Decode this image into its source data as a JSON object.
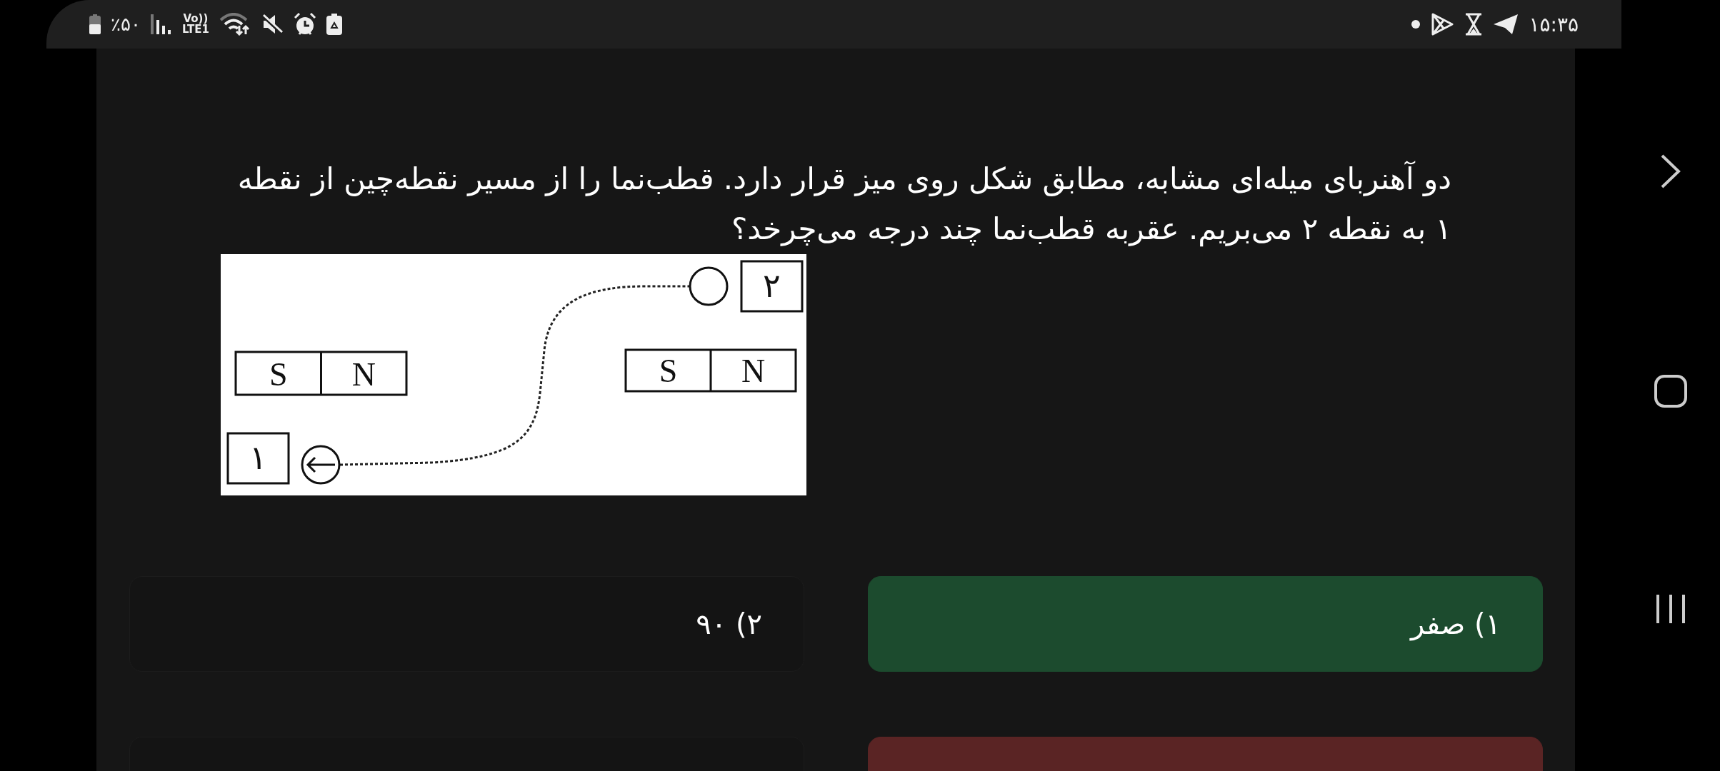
{
  "status_bar": {
    "battery": "٪۵۰",
    "network": [
      "Vo))",
      "LTE1"
    ],
    "time": "۱۵:۳۵"
  },
  "question": {
    "text": "دو آهنربای میله‌ای مشابه، مطابق شکل روی میز قرار دارد. قطب‌نما را از مسیر نقطه‌چین از نقطه ۱ به نقطه ۲ می‌بریم. عقربه قطب‌نما چند درجه می‌چرخد؟"
  },
  "figure": {
    "magnets": [
      {
        "left": "S",
        "right": "N"
      },
      {
        "left": "S",
        "right": "N"
      }
    ],
    "points": [
      "۱",
      "۲"
    ]
  },
  "options": [
    {
      "label": "۱) صفر",
      "correct": true,
      "wrong": false
    },
    {
      "label": "۲) ۹۰",
      "correct": false,
      "wrong": false
    },
    {
      "correct": false,
      "wrong": true
    },
    {
      "correct": false,
      "wrong": false
    }
  ]
}
